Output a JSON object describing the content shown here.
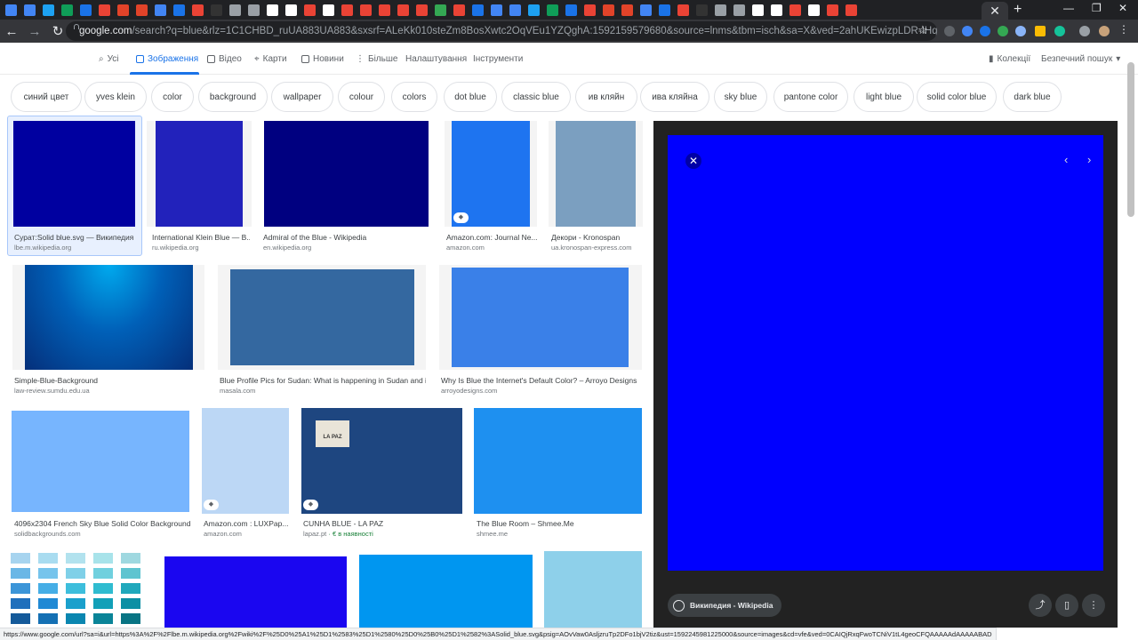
{
  "browser": {
    "url_host": "google.com",
    "url_rest": "/search?q=blue&rlz=1C1CHBD_ruUA883UA883&sxsrf=ALeKk010steZm8BosXwtc2OqVEu1YZQghA:1592159579680&source=lnms&tbm=isch&sa=X&ved=2ahUKEwizpLDR-IHqAhVkw4sKHbDLCrYQ...",
    "close_tab": "✕",
    "new_tab": "+",
    "status_url": "https://www.google.com/url?sa=i&url=https%3A%2F%2Flbe.m.wikipedia.org%2Fwiki%2F%25D0%25A1%25D1%2583%25D1%2580%25D0%25B0%25D1%2582%3ASolid_blue.svg&psig=AOvVaw0AsljzruTp2DFo1bjV2tiz&ust=1592245981225000&source=images&cd=vfe&ved=0CAIQjRxqFwoTCNiV1tL4geoCFQAAAAAdAAAAABAD"
  },
  "nav": {
    "all": "Усі",
    "images": "Зображення",
    "video": "Відео",
    "maps": "Карти",
    "news": "Новини",
    "more": "Більше",
    "settings": "Налаштування",
    "tools": "Інструменти",
    "collections": "Колекції",
    "safesearch": "Безпечний пошук"
  },
  "chips": [
    "синий цвет",
    "yves klein",
    "color",
    "background",
    "wallpaper",
    "colour",
    "colors",
    "dot blue",
    "classic blue",
    "ив кляйн",
    "ива кляйна",
    "sky blue",
    "pantone color",
    "light blue",
    "solid color blue",
    "dark blue"
  ],
  "results": [
    {
      "caption": "Сурат:Solid blue.svg — Википедия",
      "source": "lbe.m.wikipedia.org",
      "color": "#0000a0"
    },
    {
      "caption": "International Klein Blue — B...",
      "source": "ru.wikipedia.org",
      "color": "#2222bb"
    },
    {
      "caption": "Admiral of the Blue - Wikipedia",
      "source": "en.wikipedia.org",
      "color": "#000080"
    },
    {
      "caption": "Amazon.com: Journal Ne...",
      "source": "amazon.com",
      "color": "#1e74f0"
    },
    {
      "caption": "Декори - Kronospan",
      "source": "ua.kronospan-express.com",
      "color": "#7b9fc0"
    },
    {
      "caption": "Simple-Blue-Background",
      "source": "law-review.sumdu.edu.ua",
      "color": "#0a4ea0"
    },
    {
      "caption": "Blue Profile Pics for Sudan: What is happening in Sudan and i...",
      "source": "masala.com",
      "color": "#3468a0"
    },
    {
      "caption": "Why Is Blue the Internet's Default Color? – Arroyo Designs",
      "source": "arroyodesigns.com",
      "color": "#3a80e8"
    },
    {
      "caption": "4096x2304 French Sky Blue Solid Color Background",
      "source": "solidbackgrounds.com",
      "color": "#77b5fe"
    },
    {
      "caption": "Amazon.com : LUXPap...",
      "source": "amazon.com",
      "color": "#bcd7f5"
    },
    {
      "caption": "CUNHA BLUE - LA PAZ",
      "source": "lapaz.pt",
      "source_extra": " · € в наявності",
      "color": "#1e4680"
    },
    {
      "caption": "The Blue Room – Shmee.Me",
      "source": "shmee.me",
      "color": "#1e90f0"
    }
  ],
  "shirt_label": "LA PAZ",
  "preview": {
    "source_label": "Википедия - Wikipedia",
    "close_icon": "✕",
    "prev_icon": "‹",
    "next_icon": "›",
    "image_color": "#0000ff"
  }
}
